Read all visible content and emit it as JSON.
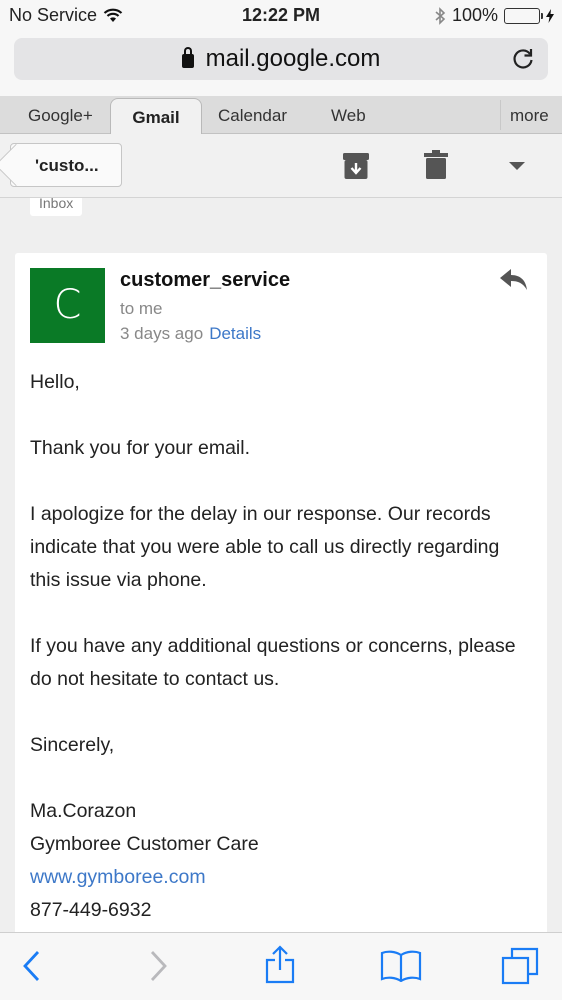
{
  "status_bar": {
    "carrier": "No Service",
    "time": "12:22 PM",
    "battery": "100%"
  },
  "browser": {
    "url": "mail.google.com"
  },
  "gmail_tabs": {
    "items": [
      "Google+",
      "Gmail",
      "Calendar",
      "Web"
    ],
    "more": "more",
    "active": "Gmail"
  },
  "toolbar": {
    "back_label": "'custo..."
  },
  "inbox_label": "Inbox",
  "message": {
    "avatar_letter": "C",
    "avatar_color": "#0a7a26",
    "sender": "customer_service",
    "to": "to me",
    "time": "3 days ago",
    "details": "Details",
    "greeting": "Hello,",
    "p1": "Thank you for your email.",
    "p2": "I apologize for the delay in our response. Our records indicate that you were able to call us directly regarding this issue via phone.",
    "p3": "If you have any additional questions or concerns, please do not hesitate to contact us.",
    "closing": "Sincerely,",
    "sig_name": "Ma.Corazon",
    "sig_org": "Gymboree Customer Care",
    "sig_link": "www.gymboree.com",
    "sig_phone": "877-449-6932"
  },
  "colors": {
    "link": "#3d78c8",
    "battery": "#4cd964"
  }
}
